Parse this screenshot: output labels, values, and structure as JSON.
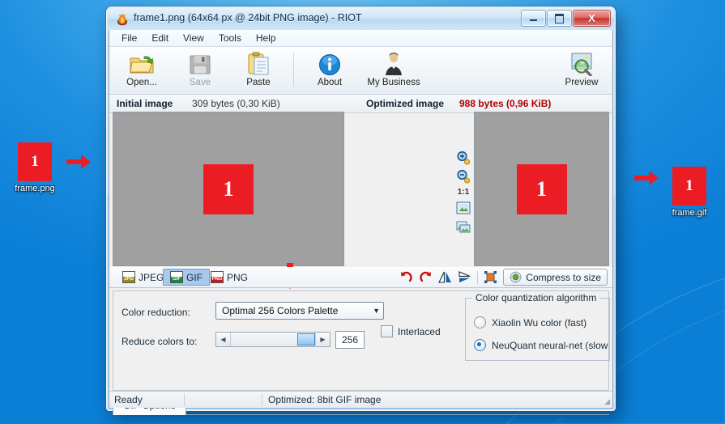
{
  "desktop": {
    "left_icon": {
      "thumb_text": "1",
      "label": "frame.png",
      "color": "#ec1c24"
    },
    "right_icon": {
      "thumb_text": "1",
      "label": "frame.gif",
      "color": "#ec1c24"
    },
    "arrow_left_name": "right-arrow",
    "arrow_right_name": "right-arrow",
    "annotation_arrow_down": "down-arrow"
  },
  "window": {
    "title": "frame1.png (64x64 px @ 24bit PNG image) - RIOT",
    "app_icon": "riot-flame-icon",
    "buttons": {
      "minimize": "–",
      "maximize": "□",
      "close": "X"
    }
  },
  "menu": {
    "items": [
      "File",
      "Edit",
      "View",
      "Tools",
      "Help"
    ]
  },
  "toolbar": {
    "items": [
      {
        "label": "Open...",
        "icon": "open-folder-icon",
        "enabled": true
      },
      {
        "label": "Save",
        "icon": "save-disk-icon",
        "enabled": false
      },
      {
        "label": "Paste",
        "icon": "paste-clipboard-icon",
        "enabled": true
      },
      {
        "label": "About",
        "icon": "info-icon",
        "enabled": true
      },
      {
        "label": "My Business",
        "icon": "businessman-icon",
        "enabled": true
      },
      {
        "label": "Preview",
        "icon": "preview-magnifier-icon",
        "enabled": true
      }
    ]
  },
  "infobar": {
    "initial_label": "Initial image",
    "initial_value": "309 bytes (0,30 KiB)",
    "optimized_label": "Optimized image",
    "optimized_value": "988 bytes (0,96 KiB)",
    "optimized_color": "#b00000"
  },
  "panes": {
    "initial": {
      "image_text": "1",
      "bg": "#a0a0a0",
      "fg": "#ec1c24"
    },
    "optimized": {
      "image_text": "1",
      "bg": "#a0a0a0",
      "fg": "#ec1c24"
    },
    "zoom_tools": [
      {
        "name": "zoom-in-icon",
        "label": ""
      },
      {
        "name": "zoom-out-icon",
        "label": ""
      },
      {
        "name": "zoom-actual-size",
        "label": "1:1"
      },
      {
        "name": "fit-to-window-icon",
        "label": ""
      },
      {
        "name": "compare-images-icon",
        "label": ""
      }
    ]
  },
  "format_tabs": {
    "items": [
      {
        "label": "JPEG",
        "icon": "jpg-file-icon",
        "badge": "JPG",
        "badge_color": "#9a8b14",
        "active": false
      },
      {
        "label": "GIF",
        "icon": "gif-file-icon",
        "badge": "GIF",
        "badge_color": "#138a3e",
        "active": true
      },
      {
        "label": "PNG",
        "icon": "png-file-icon",
        "badge": "PNG",
        "badge_color": "#c01b1b",
        "active": false
      }
    ],
    "right_tools": [
      {
        "name": "rotate-left-icon"
      },
      {
        "name": "rotate-right-icon"
      },
      {
        "name": "flip-horizontal-icon"
      },
      {
        "name": "flip-vertical-icon"
      },
      {
        "name": "crop-icon"
      }
    ],
    "compress_button": {
      "label": "Compress to size",
      "icon": "gear-compress-icon"
    }
  },
  "options": {
    "color_reduction_label": "Color reduction:",
    "color_reduction_value": "Optimal 256 Colors Palette",
    "reduce_colors_label": "Reduce colors to:",
    "reduce_colors_value": "256",
    "interlaced_label": "Interlaced",
    "interlaced_checked": false,
    "quantization": {
      "group_title": "Color quantization algorithm",
      "options": [
        {
          "label": "Xiaolin Wu color (fast)",
          "selected": false
        },
        {
          "label": "NeuQuant neural-net (slow",
          "selected": true
        }
      ]
    }
  },
  "bottom_tab": {
    "label": "GIF Options"
  },
  "status": {
    "left": "Ready",
    "right": "Optimized: 8bit GIF image"
  }
}
